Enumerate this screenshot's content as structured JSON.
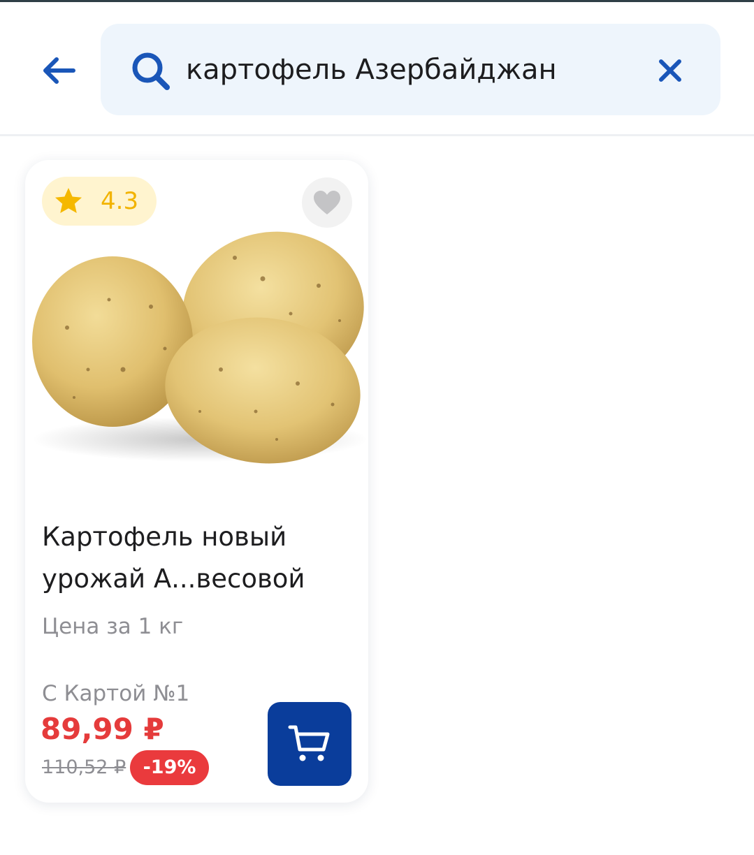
{
  "header": {
    "back_icon": "arrow-left-icon",
    "search": {
      "icon": "search-icon",
      "value": "картофель Азербайджан",
      "clear_icon": "close-icon"
    }
  },
  "product": {
    "rating": "4.3",
    "rating_icon": "star-icon",
    "favorite_icon": "heart-icon",
    "image_alt": "potatoes",
    "name": "Картофель новый\nурожай А...весовой",
    "price_unit": "Цена за 1 кг",
    "card_label": "С Картой №1",
    "price_current": "89,99 ₽",
    "price_old": "110,52 ₽",
    "discount": "-19%",
    "cart_icon": "cart-icon"
  },
  "colors": {
    "brand_blue": "#0a3d9b",
    "accent_blue": "#1a56b8",
    "price_red": "#e53b3b",
    "rating_yellow": "#f2b300"
  }
}
